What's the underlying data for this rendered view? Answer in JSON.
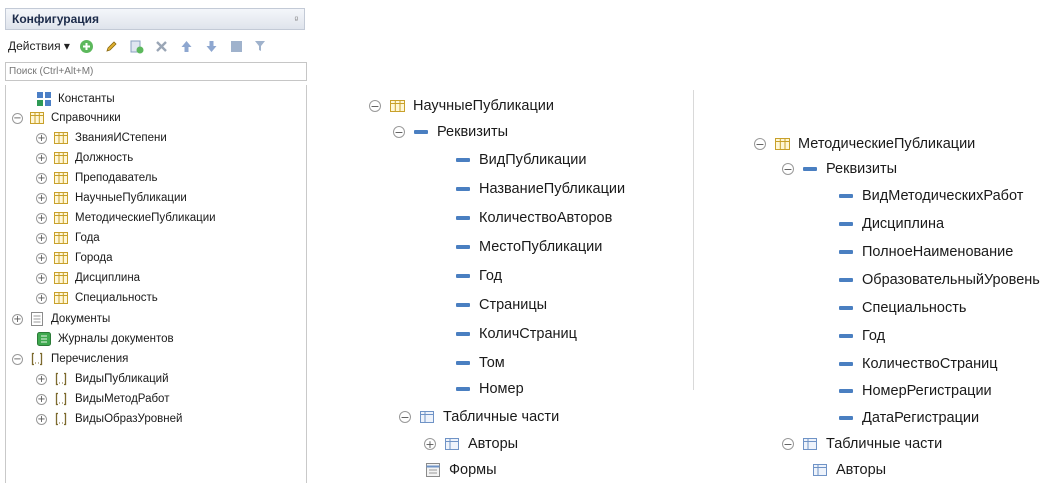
{
  "panel": {
    "title": "Конфигурация",
    "pin": "ᵍ",
    "actions_label": "Действия ▾",
    "search_placeholder": "Поиск (Ctrl+Alt+M)"
  },
  "left_tree": {
    "constants": "Константы",
    "catalogs": "Справочники",
    "catalog_items": [
      "ЗванияИСтепени",
      "Должность",
      "Преподаватель",
      "НаучныеПубликации",
      "МетодическиеПубликации",
      "Года",
      "Города",
      "Дисциплина",
      "Специальность"
    ],
    "documents": "Документы",
    "journals": "Журналы документов",
    "enums": "Перечисления",
    "enum_items": [
      "ВидыПубликаций",
      "ВидыМетодРабот",
      "ВидыОбразУровней"
    ]
  },
  "sci": {
    "title": "НаучныеПубликации",
    "attrs_label": "Реквизиты",
    "attrs": [
      "ВидПубликации",
      "НазваниеПубликации",
      "КоличествоАвторов",
      "МестоПубликации",
      "Год",
      "Страницы",
      "КоличСтраниц",
      "Том",
      "Номер"
    ],
    "tab_parts_label": "Табличные части",
    "tab_part": "Авторы",
    "forms_label": "Формы"
  },
  "met": {
    "title": "МетодическиеПубликации",
    "attrs_label": "Реквизиты",
    "attrs": [
      "ВидМетодическихРабот",
      "Дисциплина",
      "ПолноеНаименование",
      "ОбразовательныйУровень",
      "Специальность",
      "Год",
      "КоличествоСтраниц",
      "НомерРегистрации",
      "ДатаРегистрации"
    ],
    "tab_parts_label": "Табличные части",
    "tab_part": "Авторы"
  },
  "colors": {
    "catalog_icon": "#c8a02a",
    "attr_dash": "#4a7fc1",
    "tab_part_icon": "#6f93c6",
    "toggle_border": "#9a9a9a"
  }
}
